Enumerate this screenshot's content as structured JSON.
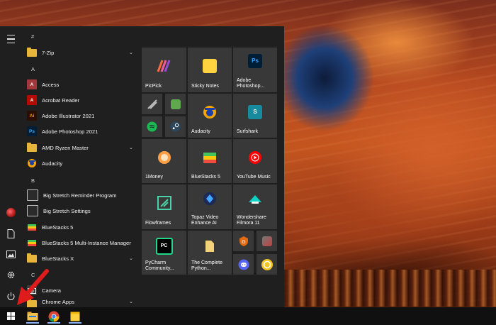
{
  "start_menu": {
    "left_rail": {
      "menu": "menu-icon",
      "user": "user-avatar-icon",
      "documents": "document-icon",
      "pictures": "pictures-icon",
      "settings": "gear-icon",
      "power": "power-icon"
    },
    "app_list": {
      "group_hash": "#",
      "group_a": "A",
      "group_b": "B",
      "group_c": "C",
      "items": {
        "zip": "7-Zip",
        "access": "Access",
        "acrobat": "Acrobat Reader",
        "illustrator": "Adobe Illustrator 2021",
        "photoshop": "Adobe Photoshop 2021",
        "amd": "AMD Ryzen Master",
        "audacity": "Audacity",
        "bigstretch_program": "Big Stretch Reminder Program",
        "bigstretch_settings": "Big Stretch Settings",
        "bluestacks5": "BlueStacks 5",
        "bluestacks_multi": "BlueStacks 5 Multi-Instance Manager",
        "bluestacksx": "BlueStacks X",
        "camera": "Camera",
        "chrome_apps": "Chrome Apps"
      },
      "icon_text": {
        "access": "A",
        "acrobat": "A",
        "illustrator": "Ai",
        "photoshop": "Ps"
      }
    },
    "tiles": {
      "picpick": "PicPick",
      "sticky_notes": "Sticky Notes",
      "photoshop": "Adobe Photoshop...",
      "photoshop_icon_text": "Ps",
      "audacity": "Audacity",
      "surfshark": "Surfshark",
      "onemoney": "1Money",
      "bluestacks5": "BlueStacks 5",
      "youtube_music": "YouTube Music",
      "flowframes": "Flowframes",
      "topaz": "Topaz Video Enhance AI",
      "filmora": "Wondershare Filmora 11",
      "pycharm": "PyCharm Community...",
      "pycharm_icon_text": "PC",
      "python_book": "The Complete Python..."
    }
  },
  "taskbar": {
    "start": "windows-start-icon",
    "file_explorer": "file-explorer-icon",
    "chrome": "chrome-icon",
    "sticky": "sticky-notes-icon"
  },
  "colors": {
    "menu_bg": "#1f1f1f",
    "tile_bg": "#383838",
    "taskbar_bg": "#101010",
    "annotation": "#e01b1b"
  }
}
